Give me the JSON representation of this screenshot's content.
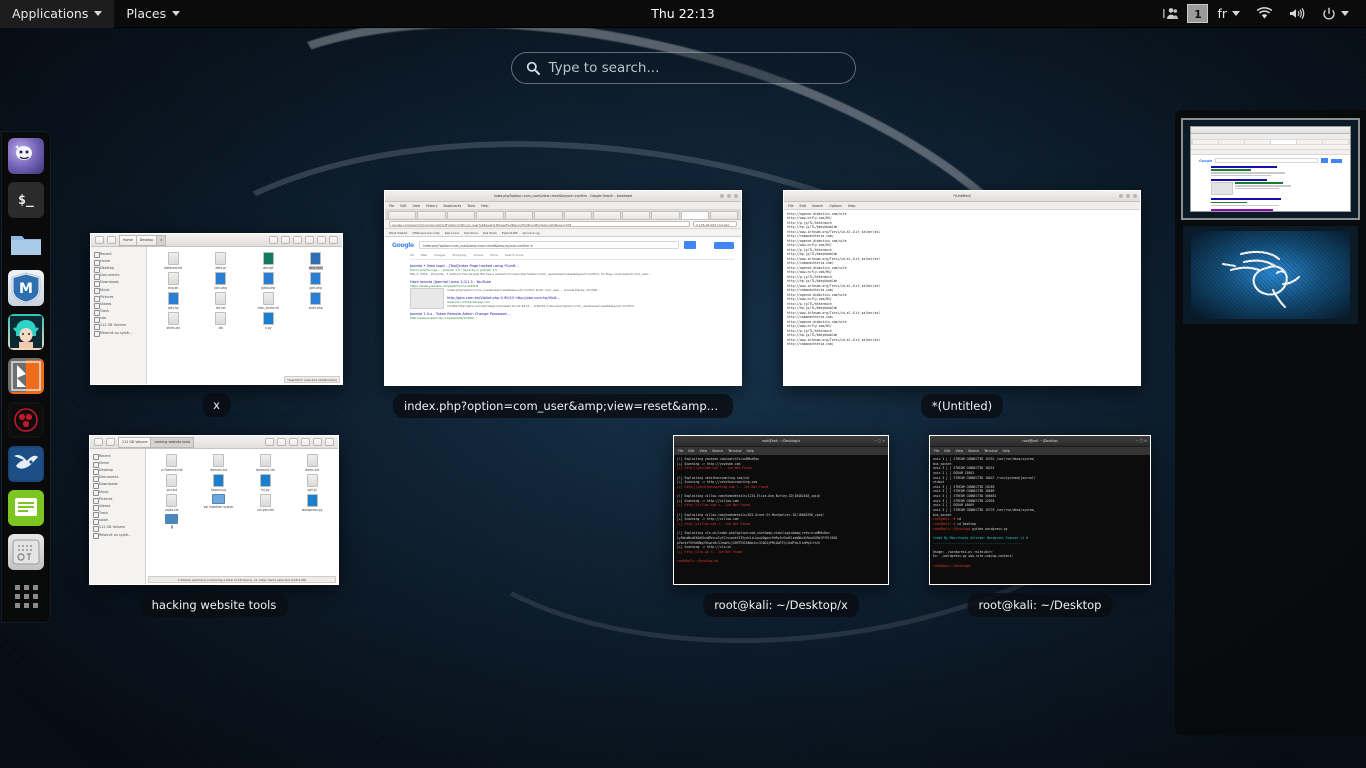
{
  "topbar": {
    "applications": "Applications",
    "places": "Places",
    "clock": "Thu 22:13",
    "keyboard_layout": "fr",
    "workspace_badge": "1",
    "icons": {
      "users": "users-icon",
      "wifi": "wifi-icon",
      "volume": "volume-icon",
      "power": "power-icon",
      "caret": "chevron-down-icon"
    }
  },
  "search": {
    "placeholder": "Type to search...",
    "icon": "search-icon"
  },
  "dock": {
    "items": [
      {
        "name": "iceweasel",
        "label": "Iceweasel",
        "running": true
      },
      {
        "name": "terminal",
        "label": "Terminal",
        "running": true,
        "glyph": "$_"
      },
      {
        "name": "files",
        "label": "Files",
        "running": true
      },
      {
        "name": "metasploit",
        "label": "Metasploit Framework",
        "running": false,
        "glyph": "M"
      },
      {
        "name": "armitage",
        "label": "Armitage",
        "running": false
      },
      {
        "name": "burpsuite",
        "label": "Burp Suite",
        "running": false
      },
      {
        "name": "maltego",
        "label": "Maltego",
        "running": false
      },
      {
        "name": "beef",
        "label": "BeEF",
        "running": false
      },
      {
        "name": "leafpad",
        "label": "Leafpad",
        "running": true
      },
      {
        "name": "device-manager",
        "label": "Device Manager",
        "running": false
      },
      {
        "name": "show-applications",
        "label": "Show Applications",
        "running": false
      }
    ]
  },
  "windows": {
    "nautilus_desktop": {
      "label": "x",
      "crumbs": [
        "Home",
        "Desktop",
        "x"
      ],
      "sidebar": [
        "Recent",
        "Home",
        "Desktop",
        "Documents",
        "Downloads",
        "Music",
        "Pictures",
        "Videos",
        "Trash",
        "sda",
        "212 GB Volume",
        "Réservé au systè..."
      ],
      "files": [
        {
          "name": "defaced.txt",
          "type": "txt"
        },
        {
          "name": "defx.pl",
          "type": "pl"
        },
        {
          "name": "dev.gif",
          "type": "gif"
        },
        {
          "name": "dew.html",
          "type": "html",
          "selected": true
        },
        {
          "name": "exp.sh",
          "type": "sh"
        },
        {
          "name": "joel.php",
          "type": "php"
        },
        {
          "name": "joeol.php",
          "type": "php"
        },
        {
          "name": "joel.php",
          "type": "php"
        },
        {
          "name": "joliy.hp",
          "type": "php"
        },
        {
          "name": "lec.txt",
          "type": "txt"
        },
        {
          "name": "man_brute.sh",
          "type": "sh"
        },
        {
          "name": "shell.php",
          "type": "php"
        },
        {
          "name": "shels.txt",
          "type": "txt"
        },
        {
          "name": "tat",
          "type": "txt"
        },
        {
          "name": "x.py",
          "type": "py"
        }
      ],
      "status": "\"dew.html\" selected (4446 bytes)"
    },
    "browser": {
      "label": "index.php?option=com_user&amp;view=reset&amp;layo...",
      "title": "index.php?option=com_user&view=reset&layout=confirm - Google Search - Iceweasel",
      "menus": [
        "File",
        "Edit",
        "View",
        "History",
        "Bookmarks",
        "Tools",
        "Help"
      ],
      "address": "google.com/search?q=index.php%3Foption%3Dcom_user%26view%3Dreset%26layout%3Dconfirm&ie=utf-8&oe=utf-8",
      "search_field": "p:195.26.209.113:site",
      "bookmarks": [
        "Most Visited",
        "Offensive Security",
        "Kali Linux",
        "Kali Docs",
        "Kali Tools",
        "Exploit-DB",
        "Aircrack-ng"
      ],
      "query": "index.php?option=com_user&amp;view=reset&amp;layout=confirm in",
      "signin": "Sign in",
      "nav": [
        "All",
        "Web",
        "Images",
        "Shopping",
        "Videos",
        "More",
        "Search tools"
      ],
      "results": [
        {
          "title": "Joomla • View topic - [Tool]Index Page hacked using *Confi...",
          "url": "forum.joomla.org/... › Joomla! 1.5 › Security in Joomla! 1.5",
          "snippet": "Feb 1, 2014 - 20 posts - 7 authors\nThe list.php file has a redirect to index.php?option=com_user&view=reset&layout=confirm. So they could exploit com_user..."
        },
        {
          "title": "Hack joomla (Joomla!) auto 1.0/1.5 - YouTube",
          "url": "https://www.youtube.com/watch?v=nvO3TLR",
          "snippet": "index.php?option=com_user&view=reset&layout=confirm Dork: com_user ... Joomla Hacks, 15,098 ..."
        },
        {
          "title": "http://pbx.com.tw/Visitxt.php 0.90/15 http://pbx.com.tw/Visit...",
          "url": "www.zix.com/hackerexp.xml",
          "snippet": "15,092 http://pbx.com.tw/?deep=z/Guest=id=2s 2014 ... 0.90/15 index.php?option=com_user&view=reset&layout=confirm"
        },
        {
          "title": "Joomla 1.5.x - Token Remote Admin Change Password...",
          "url": "http://www.exploit-db.com/exploits/11499/",
          "snippet": ""
        }
      ]
    },
    "leafpad": {
      "label": "*(Untitled)",
      "title": "*(Untitled)",
      "menus": [
        "File",
        "Edit",
        "Search",
        "Options",
        "Help"
      ],
      "lines": [
        "http://agence-didactics.com/site",
        "http://www.ncfly.com/HS/",
        "http://p.jp/TL/khtarmuch",
        "http://hp.jp/TL/bkeykbablah",
        "http://www.infosom.org/Torsi/id-al.ilit_salker/asl",
        "http://cabanachteria.com/",
        "http://agence-didactics.com/site",
        "http://www.ncfly.com/HS/",
        "http://p.jp/TL/khtarmuch",
        "http://hp.jp/TL/bkeykbablah",
        "http://www.infosom.org/Torsi/id-al.ilit_salker/asl",
        "http://cabanachteria.com/",
        "http://agence-didactics.com/site",
        "http://www.ncfly.com/HS/",
        "http://p.jp/TL/khtarmuch",
        "http://hp.jp/TL/bkeykbablah",
        "http://www.infosom.org/Torsi/id-al.ilit_salker/asl",
        "http://cabanachteria.com/",
        "http://agence-didactics.com/site",
        "http://www.ncfly.com/HS/",
        "http://p.jp/TL/khtarmuch",
        "http://hp.jp/TL/bkeykbablah",
        "http://www.infosom.org/Torsi/id-al.ilit_salker/asl",
        "http://cabanachteria.com/",
        "http://agence-didactics.com/site",
        "http://www.ncfly.com/HS/",
        "http://p.jp/TL/khtarmuch",
        "http://hp.jp/TL/bkeykbablah",
        "http://www.infosom.org/Torsi/id-al.ilit_salker/asl",
        "http://cabanachteria.com/"
      ]
    },
    "nautilus_tools": {
      "label": "hacking website tools",
      "crumbs": [
        "212 GB Volume",
        "hacking website tools"
      ],
      "sidebar": [
        "Recent",
        "Home",
        "Desktop",
        "Documents",
        "Downloads",
        "Music",
        "Pictures",
        "Videos",
        "Trash",
        "salah",
        "212 GB Volume",
        "Réservé au systè..."
      ],
      "files": [
        {
          "name": "cr7zeexcel.txt",
          "type": "txt"
        },
        {
          "name": "domain.txt",
          "type": "txt"
        },
        {
          "name": "domain2.txt",
          "type": "txt"
        },
        {
          "name": "dorks.txt",
          "type": "txt"
        },
        {
          "name": "gru.txt",
          "type": "txt"
        },
        {
          "name": "Search.py",
          "type": "py"
        },
        {
          "name": "inj.py",
          "type": "py"
        },
        {
          "name": "sqli.pl",
          "type": "pl"
        },
        {
          "name": "sqlex.txt",
          "type": "txt"
        },
        {
          "name": "sql injection scaner",
          "type": "dir"
        },
        {
          "name": "uni-pen.txt",
          "type": "txt"
        },
        {
          "name": "wordpress.py",
          "type": "py"
        },
        {
          "name": "x",
          "type": "dir",
          "selected": true
        }
      ],
      "status": "2 folders selected (containing a total of 18 items), 11 other items selected (128.9 kB)"
    },
    "terminal_x": {
      "label": "root@kali: ~/Desktop/x",
      "title": "root@kali: ~/Desktop/x",
      "menus": [
        "File",
        "Edit",
        "View",
        "Search",
        "Terminal",
        "Help"
      ],
      "lines": [
        {
          "t": "[!] Exploiting youtube.com/watch?v=zoDMwiRqu",
          "c": "w"
        },
        {
          "t": "[+] Scanning -> http://youtube.com",
          "c": "w"
        },
        {
          "t": "[+] http://youtube.com <-- Jce Not Found",
          "c": "r"
        },
        {
          "t": "",
          "c": "w"
        },
        {
          "t": "[!] Exploiting zenithaccounting.com/id/",
          "c": "w"
        },
        {
          "t": "[+] Scanning -> http://zenithaccounting.com",
          "c": "w"
        },
        {
          "t": "[+] http://zenithaccounting.com <-- Jce Not Found",
          "c": "r"
        },
        {
          "t": "",
          "c": "w"
        },
        {
          "t": "[!] Exploiting zillow.com/homedetails/1234-Eliza-Ave-Burley-ID/18402448_zpid/",
          "c": "w"
        },
        {
          "t": "[+] Scanning -> http://zillow.com",
          "c": "w"
        },
        {
          "t": "[+] http://zillow.com <-- Jce Not Found",
          "c": "r"
        },
        {
          "t": "",
          "c": "w"
        },
        {
          "t": "[!] Exploiting zillow.com/homedetails/625-Grant-St-Montpelier-ID/18603298_zpid/",
          "c": "w"
        },
        {
          "t": "[+] Scanning -> http://zillow.com",
          "c": "w"
        },
        {
          "t": "[+] http://zillow.com <-- Jce Not Found",
          "c": "r"
        },
        {
          "t": "",
          "c": "w"
        },
        {
          "t": "[!] Exploiting zlo.uk/index.php?option=com_user&amp;view=login&amp;return=aHR0cDov",
          "c": "w"
        },
        {
          "t": "Ly9aLmNvdXk5dGhvdDVvcnIyt2lvcmnkt3I5ydnlzLkpuLDgpnc9dRvJnVhdGlzdmNkx1HVoaVU9dlPY9l4I0O",
          "c": "w"
        },
        {
          "t": "pYmntzY9VhdVNg29Lwnt0c3JhobVcjZ0PZY5I6Bdotcc3l0Q1yPMLUwPITyJsdPtbJlsnMyS=fsGr",
          "c": "w"
        },
        {
          "t": "[+] Scanning -> http://zlo.uk",
          "c": "w"
        },
        {
          "t": "[+] http://zlo.uk <-- Jce Not Found",
          "c": "r"
        },
        {
          "t": "",
          "c": "w"
        },
        {
          "t": "root@kali:~/Desktop/x#",
          "c": "prompt"
        }
      ]
    },
    "terminal_desktop": {
      "label": "root@kali: ~/Desktop",
      "title": "root@kali: ~/Desktop",
      "menus": [
        "File",
        "Edit",
        "View",
        "Search",
        "Terminal",
        "Help"
      ],
      "lines": [
        {
          "t": "unix  3      [ ]         STREAM      CONNECTED     19251    /var/run/dbus/system_",
          "c": "w"
        },
        {
          "t": "bus_socket",
          "c": "w"
        },
        {
          "t": "unix  3      [ ]         STREAM      CONNECTED     18251",
          "c": "w"
        },
        {
          "t": "unix  2      [ ]         DGRAM                     15863",
          "c": "w"
        },
        {
          "t": "unix  3      [ ]         STREAM      CONNECTED     18647    /run/systemd/journal/",
          "c": "w"
        },
        {
          "t": "stdout",
          "c": "w"
        },
        {
          "t": "unix  3      [ ]         STREAM      CONNECTED     20285",
          "c": "w"
        },
        {
          "t": "unix  3      [ ]         STREAM      CONNECTED     18669",
          "c": "w"
        },
        {
          "t": "unix  3      [ ]         STREAM      CONNECTED     500652",
          "c": "w"
        },
        {
          "t": "unix  3      [ ]         STREAM      CONNECTED     22655",
          "c": "w"
        },
        {
          "t": "unix  2      [ ]         DGRAM                     18669",
          "c": "w"
        },
        {
          "t": "unix  3      [ ]         STREAM      CONNECTED     19725    /var/run/dbus/system_",
          "c": "w"
        },
        {
          "t": "bus_socket",
          "c": "w"
        },
        {
          "t": "root@kali:~# cd",
          "c": "prompt"
        },
        {
          "t": "root@kali:~# cd Desktop",
          "c": "prompt"
        },
        {
          "t": "root@kali:~/Desktop# python wordpress.py",
          "c": "prompt"
        },
        {
          "t": "",
          "c": "w"
        },
        {
          "t": "        Coded By Mauritania Attacker Wordpress Scanner v1.0",
          "c": "c"
        },
        {
          "t": "        ------------------------------------------------",
          "c": "c"
        },
        {
          "t": "",
          "c": "w"
        },
        {
          "t": "Usage: ./wordpress.py <site+dir>",
          "c": "w"
        },
        {
          "t": "Ex: ./wordpress.py www.site.com/wp-content/",
          "c": "w"
        },
        {
          "t": "",
          "c": "w"
        },
        {
          "t": "root@kali:~/Desktop#",
          "c": "prompt"
        }
      ]
    }
  },
  "workspaces": {
    "items": [
      {
        "name": "workspace-1",
        "selected": true,
        "content": "browser-window"
      },
      {
        "name": "workspace-2",
        "selected": false,
        "content": "kali-desktop"
      }
    ]
  }
}
